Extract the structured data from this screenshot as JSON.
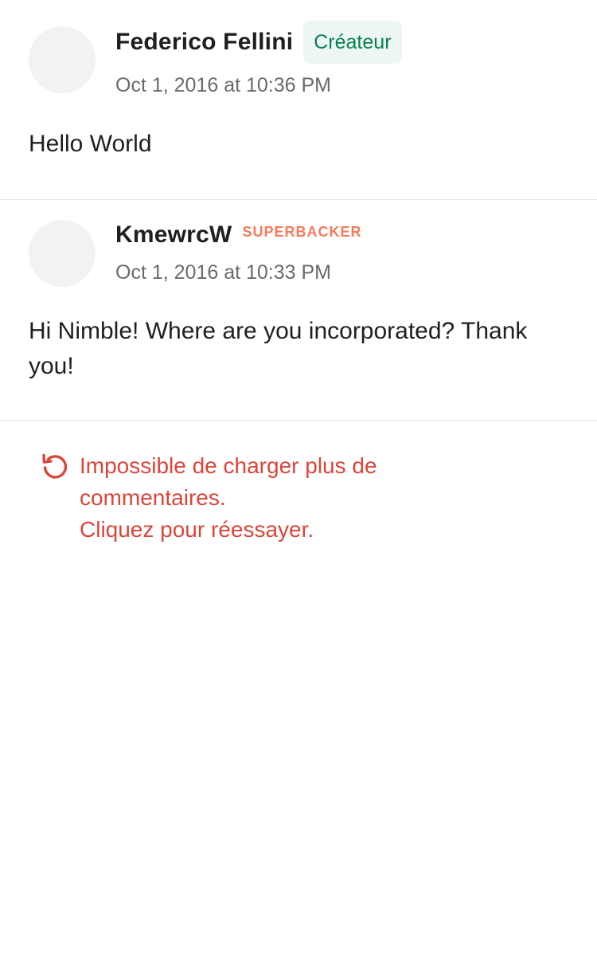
{
  "comments": [
    {
      "author": "Federico Fellini",
      "badge": "Créateur",
      "timestamp": "Oct 1, 2016 at 10:36 PM",
      "body": "Hello World"
    },
    {
      "author": "KmewrcW",
      "badge": "SUPERBACKER",
      "timestamp": "Oct 1, 2016 at 10:33 PM",
      "body": "Hi Nimble! Where are you incorporated? Thank you!"
    }
  ],
  "error": {
    "icon": "retry-icon",
    "line1": "Impossible de charger plus de",
    "line2": "commentaires.",
    "line3": "Cliquez pour réessayer."
  },
  "colors": {
    "creator_badge_bg": "#eef6f1",
    "creator_badge_text": "#068054",
    "superbacker": "#f47a5b",
    "error": "#d9463a"
  }
}
